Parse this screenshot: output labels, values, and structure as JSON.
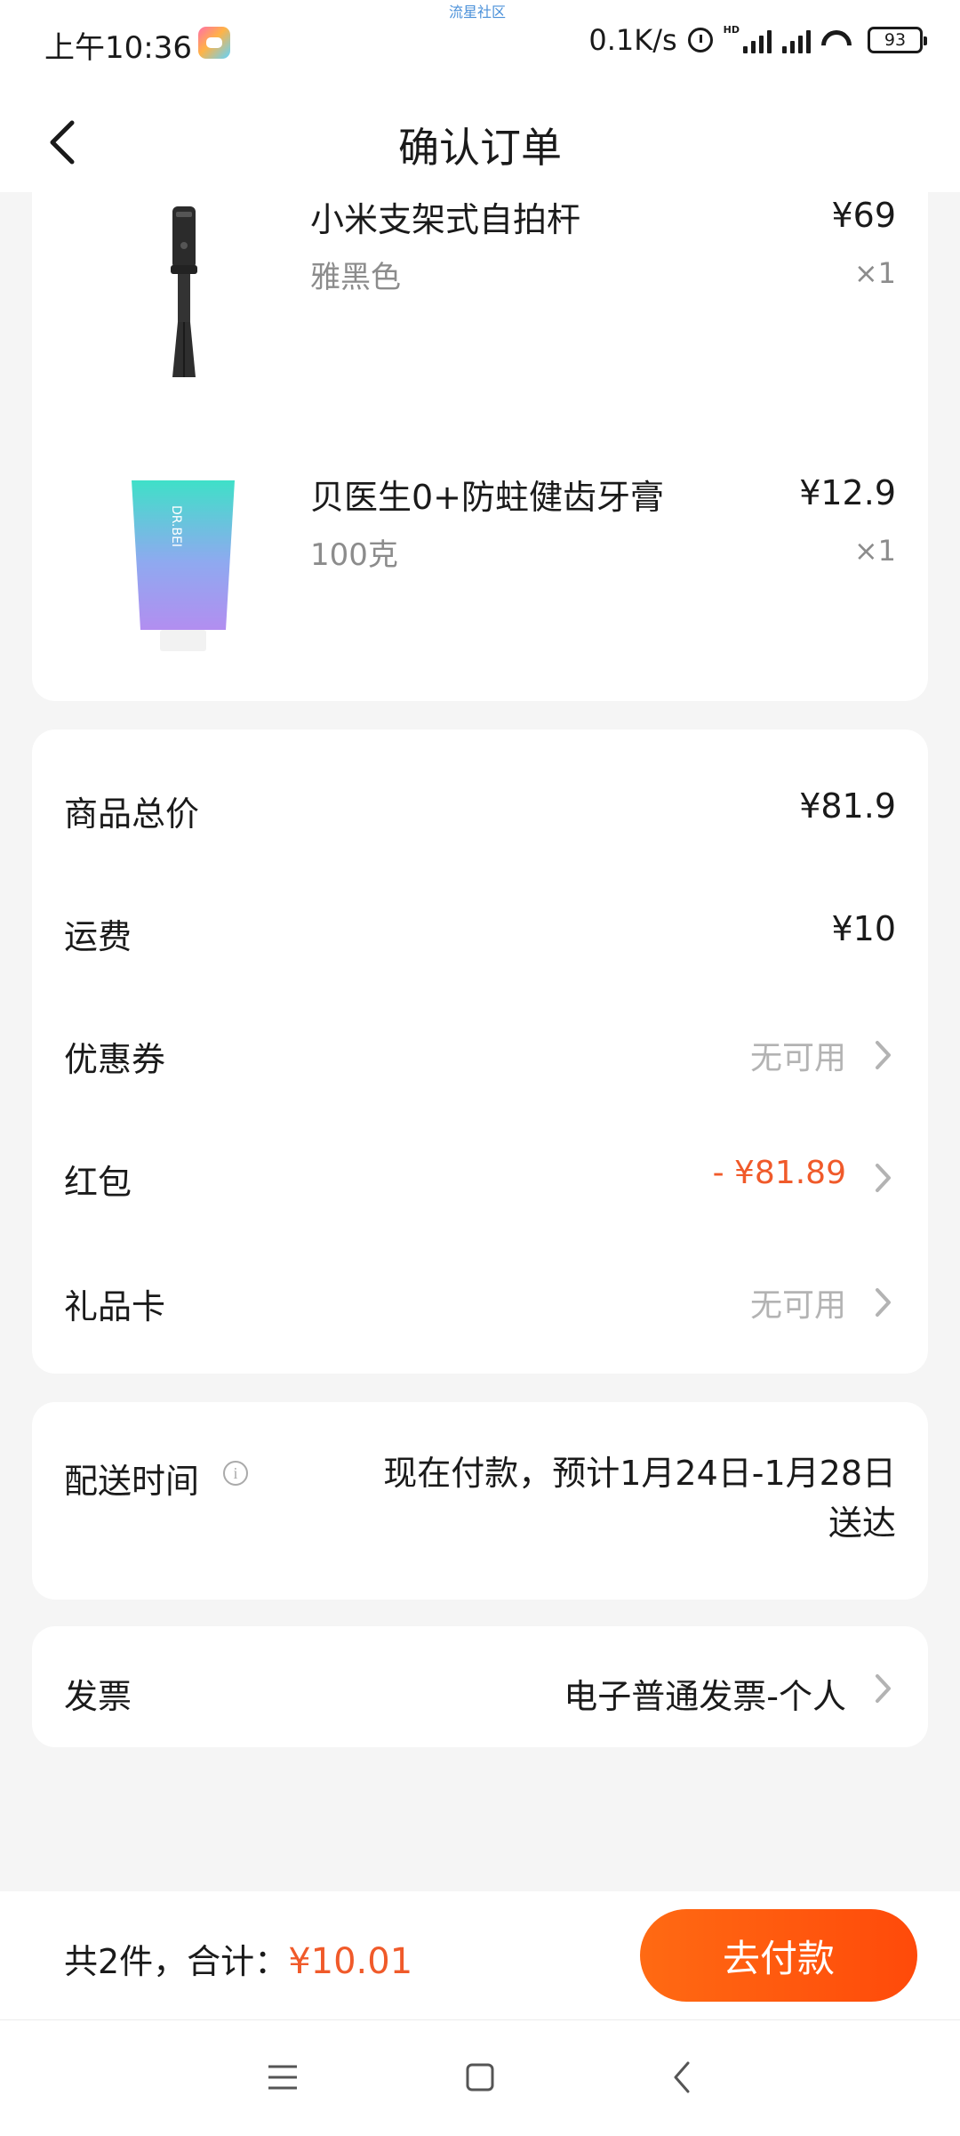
{
  "status_bar": {
    "time": "上午10:36",
    "watermark": "流星社区",
    "network_speed": "0.1K/s",
    "hd_label": "HD",
    "battery": "93",
    "icons": [
      "game-app-icon",
      "alarm-icon",
      "signal-icon",
      "signal-icon",
      "wifi-icon",
      "battery-icon"
    ]
  },
  "header": {
    "title": "确认订单",
    "back_icon": "chevron-left-icon"
  },
  "products": [
    {
      "name": "小米支架式自拍杆",
      "variant": "雅黑色",
      "price": "¥69",
      "qty": "×1",
      "image": "selfie-stick-image"
    },
    {
      "name": "贝医生0+防蛀健齿牙膏",
      "variant": "100克",
      "price": "¥12.9",
      "qty": "×1",
      "image": "toothpaste-image"
    }
  ],
  "fees": {
    "subtotal": {
      "label": "商品总价",
      "value": "¥81.9"
    },
    "shipping": {
      "label": "运费",
      "value": "¥10"
    },
    "coupon": {
      "label": "优惠券",
      "value": "无可用"
    },
    "red_packet": {
      "label": "红包",
      "value": "- ¥81.89"
    },
    "gift_card": {
      "label": "礼品卡",
      "value": "无可用"
    }
  },
  "delivery": {
    "label": "配送时间",
    "value": "现在付款，预计1月24日-1月28日送达"
  },
  "invoice": {
    "label": "发票",
    "value": "电子普通发票-个人"
  },
  "footer": {
    "summary_prefix": "共2件，合计：",
    "total": "¥10.01",
    "pay_button": "去付款"
  },
  "colors": {
    "accent": "#f05a2a",
    "pay_button_gradient": [
      "#ff6a13",
      "#ff4a0a"
    ],
    "background": "#f5f5f5"
  }
}
